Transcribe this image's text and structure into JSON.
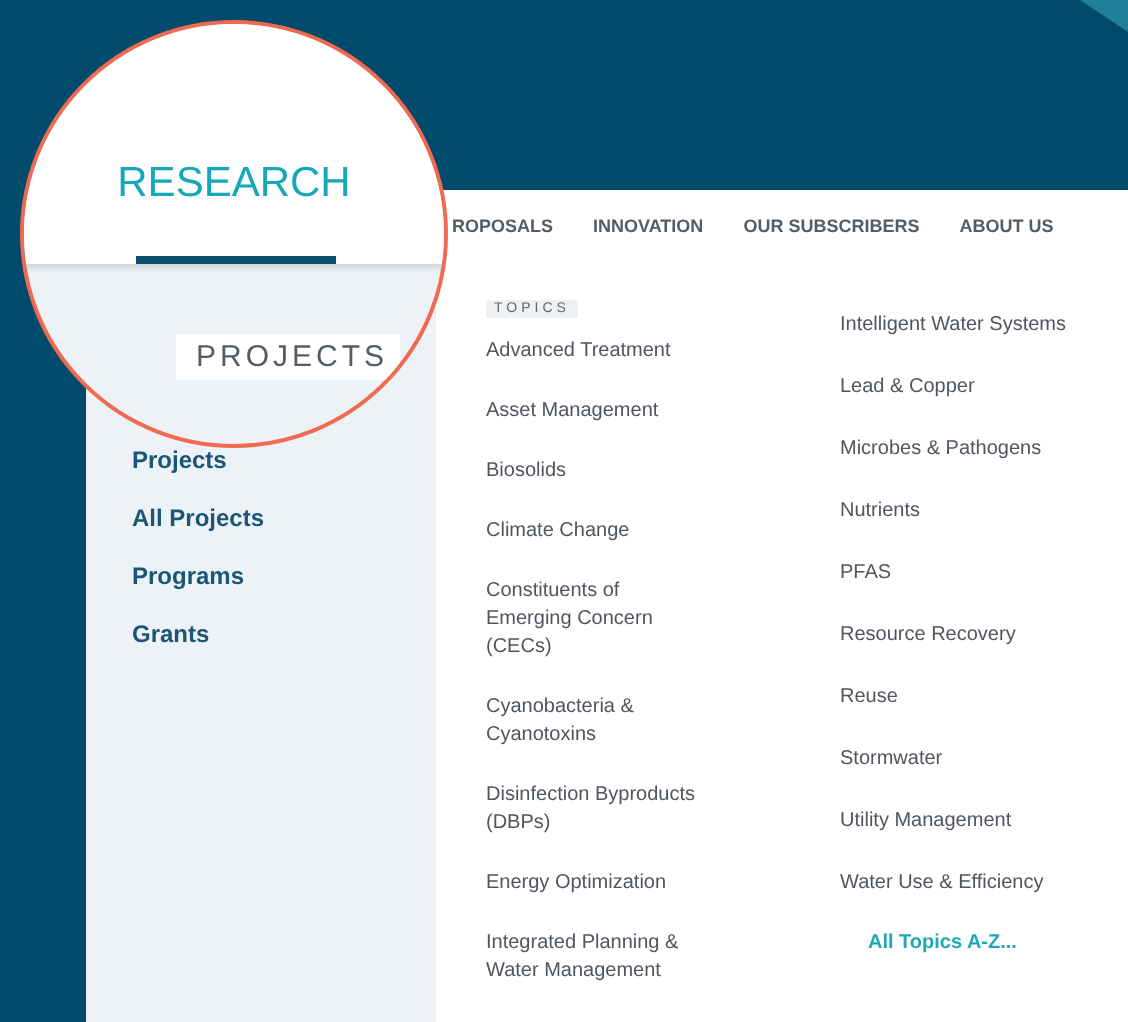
{
  "nav": [
    {
      "label": "ROPOSALS"
    },
    {
      "label": "INNOVATION"
    },
    {
      "label": "OUR SUBSCRIBERS"
    },
    {
      "label": "ABOUT US"
    }
  ],
  "magnifier": {
    "title": "RESEARCH",
    "section": "PROJECTS"
  },
  "sidebar": {
    "items": [
      {
        "label": "Projects"
      },
      {
        "label": "All Projects"
      },
      {
        "label": "Programs"
      },
      {
        "label": "Grants"
      }
    ]
  },
  "topics": {
    "heading": "TOPICS",
    "column_1": [
      "Advanced Treatment",
      "Asset Management",
      "Biosolids",
      "Climate Change",
      "Constituents of Emerging Concern (CECs)",
      "Cyanobacteria & Cyanotoxins",
      "Disinfection Byproducts (DBPs)",
      "Energy Optimization",
      "Integrated Planning & Water Management"
    ],
    "column_2": [
      "Intelligent Water Systems",
      "Lead & Copper",
      "Microbes & Pathogens",
      "Nutrients",
      "PFAS",
      "Resource Recovery",
      "Reuse",
      "Stormwater",
      "Utility Management",
      "Water Use & Efficiency"
    ],
    "all_link": "All Topics A-Z..."
  }
}
